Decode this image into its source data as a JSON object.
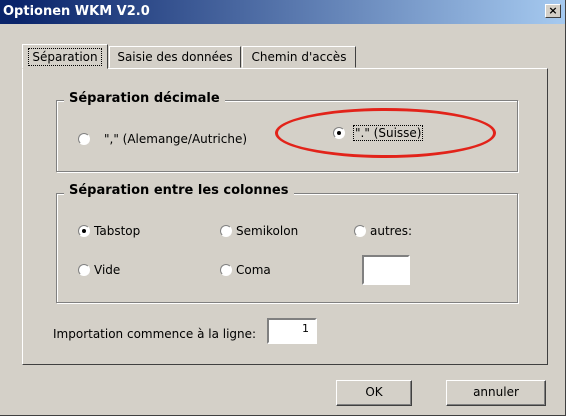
{
  "window": {
    "title": "Optionen WKM V2.0",
    "close_glyph": "×"
  },
  "tabs": [
    {
      "label": "Séparation",
      "active": true
    },
    {
      "label": "Saisie des données",
      "active": false
    },
    {
      "label": "Chemin d'accès",
      "active": false
    }
  ],
  "decimal_group": {
    "title": "Séparation décimale",
    "options": [
      {
        "label": "\",\" (Alemange/Autriche)",
        "selected": false
      },
      {
        "label": "\".\" (Suisse)",
        "selected": true
      }
    ]
  },
  "columns_group": {
    "title": "Séparation entre les colonnes",
    "options": [
      {
        "label": "Tabstop",
        "selected": true
      },
      {
        "label": "Semikolon",
        "selected": false
      },
      {
        "label": "autres:",
        "selected": false
      },
      {
        "label": "Vide",
        "selected": false
      },
      {
        "label": "Coma",
        "selected": false
      }
    ],
    "other_value": ""
  },
  "import": {
    "label": "Importation  commence à la ligne:",
    "value": "1"
  },
  "buttons": {
    "ok": "OK",
    "cancel": "annuler"
  },
  "colors": {
    "highlight_oval": "#e2231a",
    "title_bar": "#0a246a",
    "face": "#d4d0c8"
  }
}
